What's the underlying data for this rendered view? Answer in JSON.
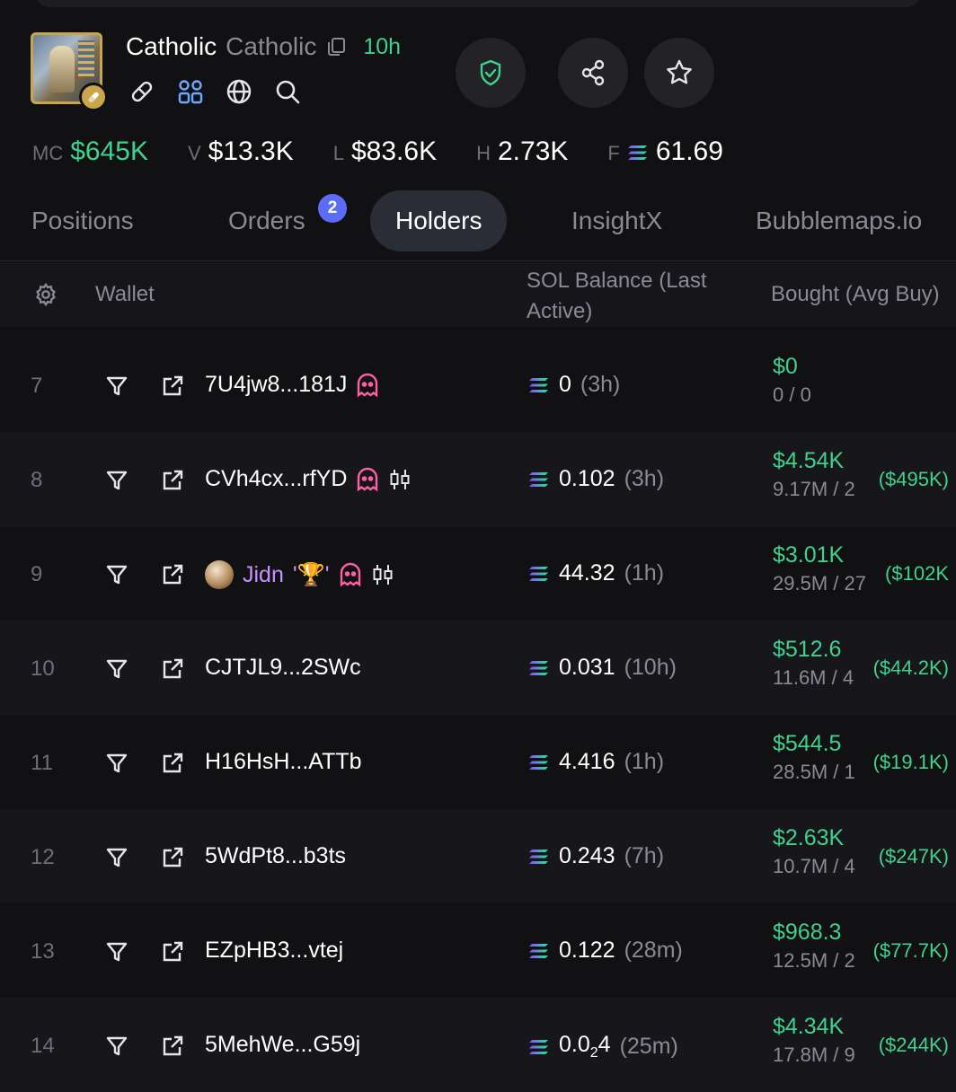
{
  "token": {
    "name": "Catholic",
    "symbol": "Catholic",
    "age": "10h"
  },
  "stats": [
    {
      "label": "MC",
      "value": "$645K",
      "accent": "green"
    },
    {
      "label": "V",
      "value": "$13.3K"
    },
    {
      "label": "L",
      "value": "$83.6K"
    },
    {
      "label": "H",
      "value": "2.73K"
    },
    {
      "label": "F",
      "value": "61.69",
      "icon": "solana-icon"
    }
  ],
  "tabs": [
    {
      "label": "Positions"
    },
    {
      "label": "Orders",
      "badge": "2"
    },
    {
      "label": "Holders",
      "active": true
    },
    {
      "label": "InsightX"
    },
    {
      "label": "Bubblemaps.io"
    }
  ],
  "table": {
    "headers": {
      "wallet": "Wallet",
      "sol_balance": "SOL Balance (Last Active)",
      "bought": "Bought (Avg Buy)"
    },
    "rows": [
      {
        "rank": "7",
        "wallet": "7U4jw8...181J",
        "sol": "0",
        "last": "(3h)",
        "bought_usd": "$0",
        "bought_qty": "0 / 0",
        "avg": ""
      },
      {
        "rank": "8",
        "wallet": "CVh4cx...rfYD",
        "sol": "0.102",
        "last": "(3h)",
        "bought_usd": "$4.54K",
        "bought_qty": "9.17M / 2",
        "avg": "($495K)"
      },
      {
        "rank": "9",
        "wallet": "Jidn",
        "trophy": "'♉'",
        "sol": "44.32",
        "last": "(1h)",
        "bought_usd": "$3.01K",
        "bought_qty": "29.5M / 27",
        "avg": "($102K"
      },
      {
        "rank": "10",
        "wallet": "CJTJL9...2SWc",
        "sol": "0.031",
        "last": "(10h)",
        "bought_usd": "$512.6",
        "bought_qty": "11.6M / 4",
        "avg": "($44.2K)"
      },
      {
        "rank": "11",
        "wallet": "H16HsH...ATTb",
        "sol": "4.416",
        "last": "(1h)",
        "bought_usd": "$544.5",
        "bought_qty": "28.5M / 1",
        "avg": "($19.1K)"
      },
      {
        "rank": "12",
        "wallet": "5WdPt8...b3ts",
        "sol": "0.243",
        "last": "(7h)",
        "bought_usd": "$2.63K",
        "bought_qty": "10.7M / 4",
        "avg": "($247K)"
      },
      {
        "rank": "13",
        "wallet": "EZpHB3...vtej",
        "sol": "0.122",
        "last": "(28m)",
        "bought_usd": "$968.3",
        "bought_qty": "12.5M / 2",
        "avg": "($77.7K)"
      },
      {
        "rank": "14",
        "wallet": "5MehWe...G59j",
        "sol": "0.0",
        "sol_sub": "2",
        "sol_tail": "4",
        "last": "(25m)",
        "bought_usd": "$4.34K",
        "bought_qty": "17.8M / 9",
        "avg": "($244K)"
      }
    ]
  },
  "colors": {
    "background": "#111114",
    "accent_green": "#3fd28c",
    "badge_blue": "#5b6cf6",
    "ghost_pink": "#ff5fa2",
    "named_purple": "#c792ff"
  }
}
